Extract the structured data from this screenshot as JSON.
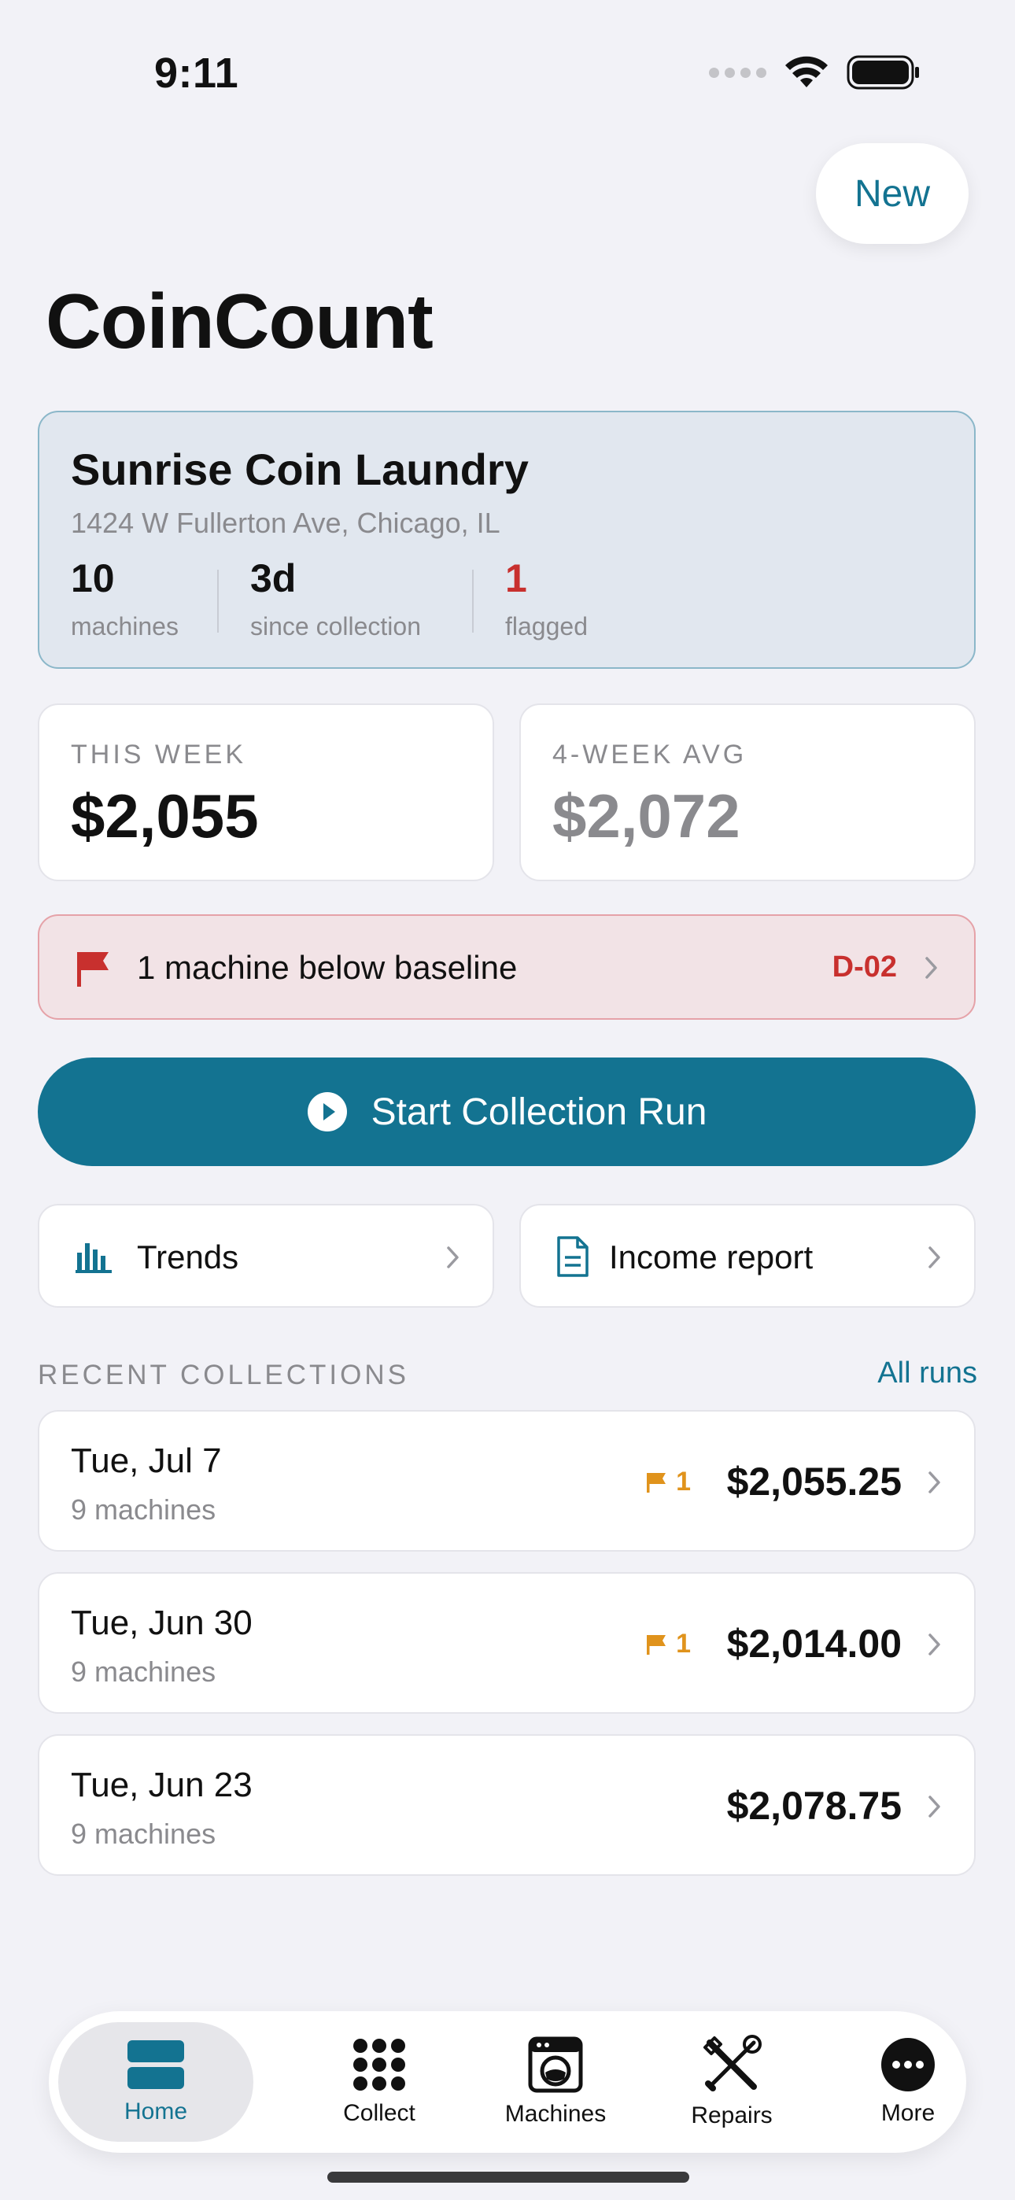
{
  "status_bar": {
    "time": "9:11"
  },
  "header": {
    "new_label": "New",
    "title": "CoinCount"
  },
  "location": {
    "name": "Sunrise Coin Laundry",
    "address": "1424 W Fullerton Ave, Chicago, IL",
    "stats": [
      {
        "value": "10",
        "label": "machines"
      },
      {
        "value": "3d",
        "label": "since collection"
      },
      {
        "value": "1",
        "label": "flagged"
      }
    ]
  },
  "metrics": {
    "this_week": {
      "label": "THIS WEEK",
      "value": "$2,055"
    },
    "avg": {
      "label": "4-WEEK AVG",
      "value": "$2,072"
    }
  },
  "alert": {
    "text": "1 machine below baseline",
    "code": "D-02"
  },
  "start_button": {
    "label": "Start Collection Run"
  },
  "quick_links": {
    "trends": "Trends",
    "income": "Income report"
  },
  "recent": {
    "header": "RECENT COLLECTIONS",
    "all_runs": "All runs",
    "rows": [
      {
        "date": "Tue, Jul 7",
        "machines": "9 machines",
        "flags": "1",
        "amount": "$2,055.25"
      },
      {
        "date": "Tue, Jun 30",
        "machines": "9 machines",
        "flags": "1",
        "amount": "$2,014.00"
      },
      {
        "date": "Tue, Jun 23",
        "machines": "9 machines",
        "flags": "",
        "amount": "$2,078.75"
      }
    ]
  },
  "tabs": [
    {
      "label": "Home"
    },
    {
      "label": "Collect"
    },
    {
      "label": "Machines"
    },
    {
      "label": "Repairs"
    },
    {
      "label": "More"
    }
  ],
  "colors": {
    "accent": "#137391",
    "danger": "#c8302e",
    "warning": "#e0931c",
    "background": "#f2f2f7"
  }
}
